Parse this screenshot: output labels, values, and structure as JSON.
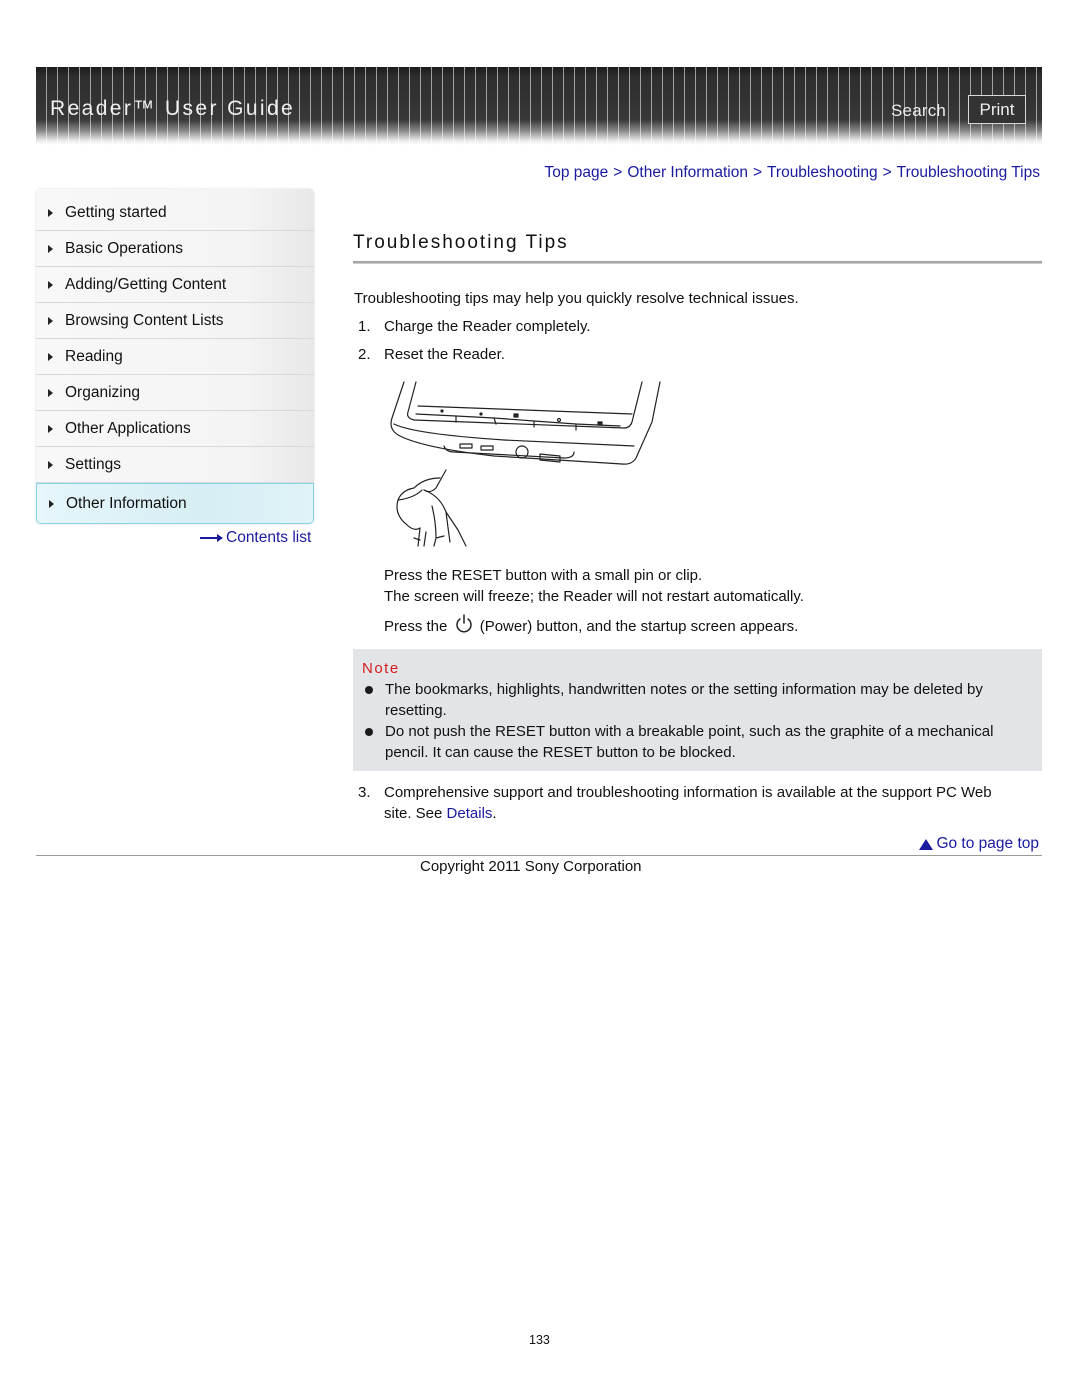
{
  "header": {
    "title": "Reader™ User Guide",
    "search_label": "Search",
    "print_label": "Print"
  },
  "sidebar": {
    "items": [
      {
        "label": "Getting started",
        "active": false
      },
      {
        "label": "Basic Operations",
        "active": false
      },
      {
        "label": "Adding/Getting Content",
        "active": false
      },
      {
        "label": "Browsing Content Lists",
        "active": false
      },
      {
        "label": "Reading",
        "active": false
      },
      {
        "label": "Organizing",
        "active": false
      },
      {
        "label": "Other Applications",
        "active": false
      },
      {
        "label": "Settings",
        "active": false
      },
      {
        "label": "Other Information",
        "active": true
      }
    ],
    "contents_list_label": "Contents list"
  },
  "breadcrumb": {
    "items": [
      "Top page",
      "Other Information",
      "Troubleshooting",
      "Troubleshooting Tips"
    ],
    "separator": ">"
  },
  "main": {
    "title": "Troubleshooting Tips",
    "intro": "Troubleshooting tips may help you quickly resolve technical issues.",
    "steps": [
      {
        "number": "1.",
        "text": "Charge the Reader completely."
      },
      {
        "number": "2.",
        "text": "Reset the Reader."
      }
    ],
    "illustration_alt": "Pressing the RESET button on the bottom of the Reader with a pin",
    "reset_instructions": {
      "line1": "Press the RESET button with a small pin or clip.",
      "line2": "The screen will freeze; the Reader will not restart automatically.",
      "line3_before": "Press the",
      "line3_after": "(Power) button, and the startup screen appears."
    },
    "note": {
      "title": "Note",
      "items": [
        {
          "line1": "The bookmarks, highlights, handwritten notes or the setting information may be deleted by",
          "line2": "resetting."
        },
        {
          "line1": "Do not push the RESET button with a breakable point, such as the graphite of a mechanical",
          "line2": "pencil. It can cause the RESET button to be blocked."
        }
      ]
    },
    "step3": {
      "number": "3.",
      "line1": "Comprehensive support and troubleshooting information is available at the support PC Web",
      "line2_before": "site. See",
      "link": "Details",
      "line2_after": "."
    }
  },
  "footer": {
    "go_to_top_label": "Go to page top",
    "copyright": "Copyright 2011 Sony Corporation",
    "page_number": "133"
  },
  "colors": {
    "link": "#1a1aa0",
    "note_title": "#d21e1e",
    "note_background": "#e2e4e7",
    "active_nav_border": "#86d4e8"
  }
}
